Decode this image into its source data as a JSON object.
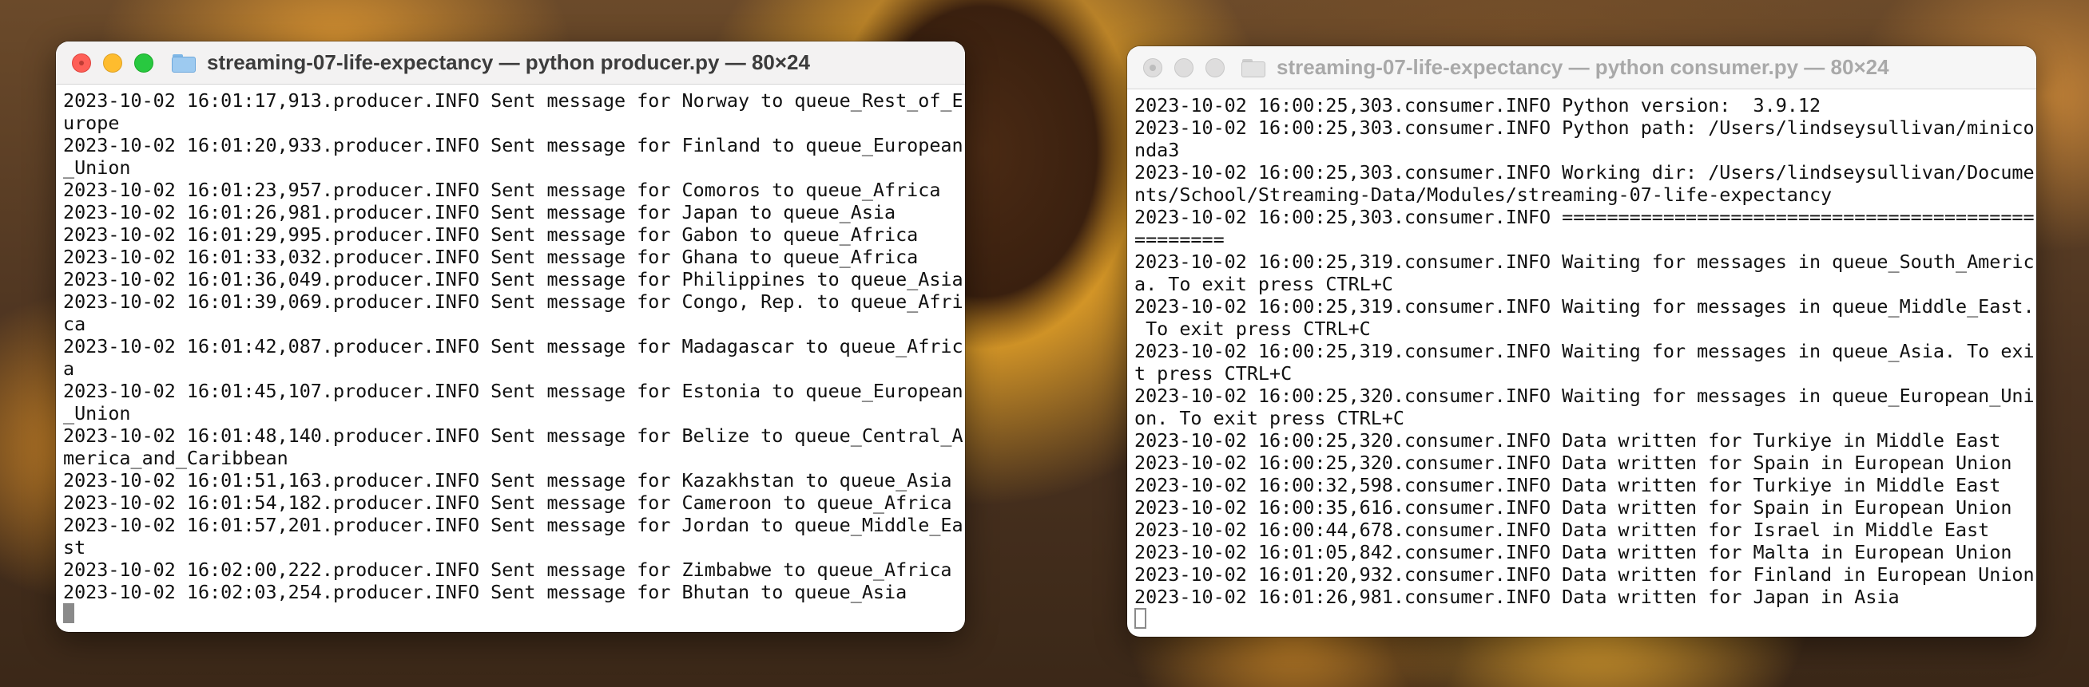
{
  "colors": {
    "close": "#fe5f57",
    "minimize": "#febc2e",
    "zoom": "#28c840",
    "inactive_light": "#dedddd"
  },
  "producer_window": {
    "title": "streaming-07-life-expectancy — python producer.py — 80×24",
    "icon": "folder-icon",
    "lines": [
      "2023-10-02 16:01:17,913.producer.INFO Sent message for Norway to queue_Rest_of_E",
      "urope",
      "2023-10-02 16:01:20,933.producer.INFO Sent message for Finland to queue_European",
      "_Union",
      "2023-10-02 16:01:23,957.producer.INFO Sent message for Comoros to queue_Africa",
      "2023-10-02 16:01:26,981.producer.INFO Sent message for Japan to queue_Asia",
      "2023-10-02 16:01:29,995.producer.INFO Sent message for Gabon to queue_Africa",
      "2023-10-02 16:01:33,032.producer.INFO Sent message for Ghana to queue_Africa",
      "2023-10-02 16:01:36,049.producer.INFO Sent message for Philippines to queue_Asia",
      "2023-10-02 16:01:39,069.producer.INFO Sent message for Congo, Rep. to queue_Afri",
      "ca",
      "2023-10-02 16:01:42,087.producer.INFO Sent message for Madagascar to queue_Afric",
      "a",
      "2023-10-02 16:01:45,107.producer.INFO Sent message for Estonia to queue_European",
      "_Union",
      "2023-10-02 16:01:48,140.producer.INFO Sent message for Belize to queue_Central_A",
      "merica_and_Caribbean",
      "2023-10-02 16:01:51,163.producer.INFO Sent message for Kazakhstan to queue_Asia",
      "2023-10-02 16:01:54,182.producer.INFO Sent message for Cameroon to queue_Africa",
      "2023-10-02 16:01:57,201.producer.INFO Sent message for Jordan to queue_Middle_Ea",
      "st",
      "2023-10-02 16:02:00,222.producer.INFO Sent message for Zimbabwe to queue_Africa",
      "2023-10-02 16:02:03,254.producer.INFO Sent message for Bhutan to queue_Asia"
    ]
  },
  "consumer_window": {
    "title": "streaming-07-life-expectancy — python consumer.py — 80×24",
    "icon": "folder-icon",
    "lines": [
      "2023-10-02 16:00:25,303.consumer.INFO Python version:  3.9.12",
      "2023-10-02 16:00:25,303.consumer.INFO Python path: /Users/lindseysullivan/minico",
      "nda3",
      "2023-10-02 16:00:25,303.consumer.INFO Working dir: /Users/lindseysullivan/Docume",
      "nts/School/Streaming-Data/Modules/streaming-07-life-expectancy",
      "2023-10-02 16:00:25,303.consumer.INFO ==========================================",
      "========",
      "2023-10-02 16:00:25,319.consumer.INFO Waiting for messages in queue_South_Americ",
      "a. To exit press CTRL+C",
      "2023-10-02 16:00:25,319.consumer.INFO Waiting for messages in queue_Middle_East.",
      " To exit press CTRL+C",
      "2023-10-02 16:00:25,319.consumer.INFO Waiting for messages in queue_Asia. To exi",
      "t press CTRL+C",
      "2023-10-02 16:00:25,320.consumer.INFO Waiting for messages in queue_European_Uni",
      "on. To exit press CTRL+C",
      "2023-10-02 16:00:25,320.consumer.INFO Data written for Turkiye in Middle East",
      "2023-10-02 16:00:25,320.consumer.INFO Data written for Spain in European Union",
      "2023-10-02 16:00:32,598.consumer.INFO Data written for Turkiye in Middle East",
      "2023-10-02 16:00:35,616.consumer.INFO Data written for Spain in European Union",
      "2023-10-02 16:00:44,678.consumer.INFO Data written for Israel in Middle East",
      "2023-10-02 16:01:05,842.consumer.INFO Data written for Malta in European Union",
      "2023-10-02 16:01:20,932.consumer.INFO Data written for Finland in European Union",
      "2023-10-02 16:01:26,981.consumer.INFO Data written for Japan in Asia"
    ]
  }
}
